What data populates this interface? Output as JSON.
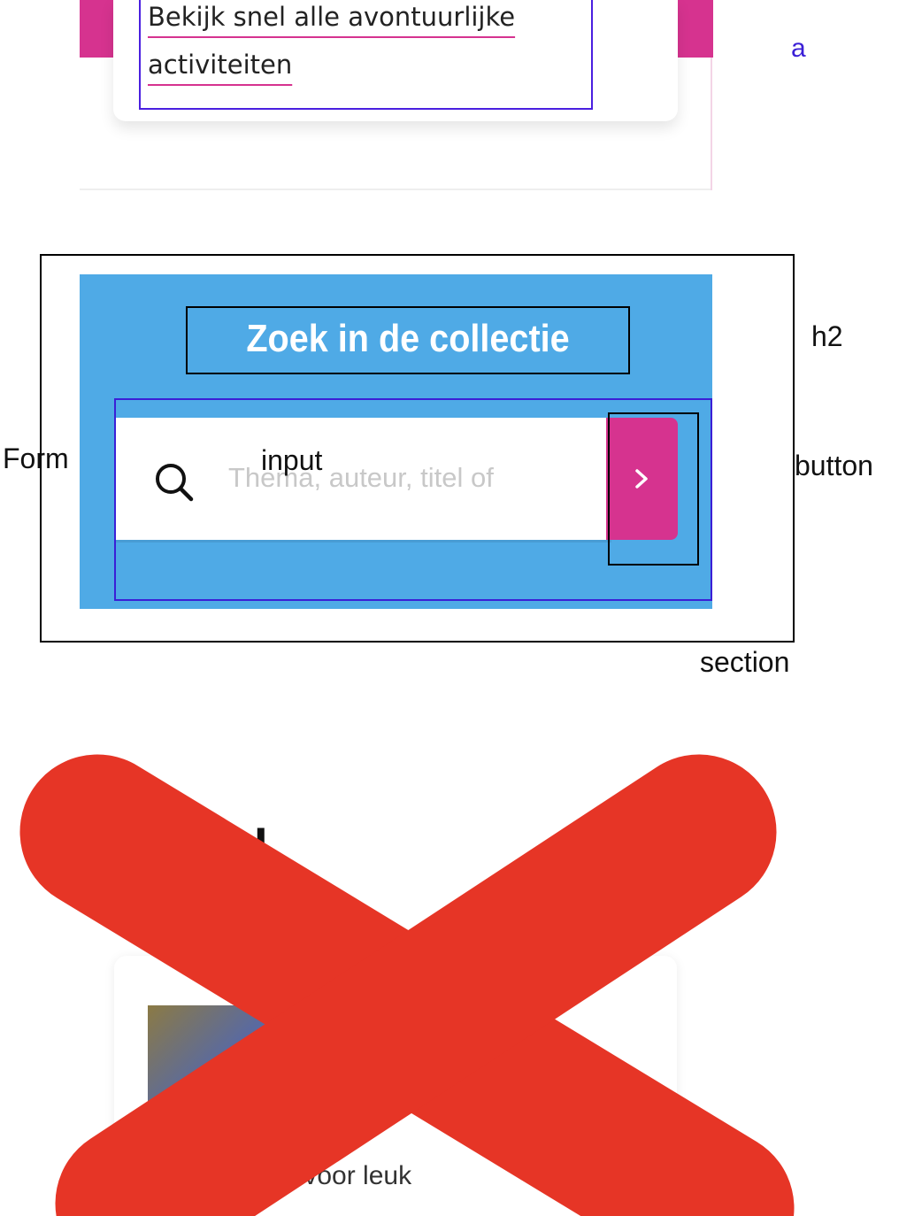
{
  "prev_card": {
    "link_text": "Bekijk snel alle avontuurlijke activiteiten",
    "accent_color": "#d6338f"
  },
  "search_section": {
    "title": "Zoek in de collectie",
    "input_placeholder": "Thema, auteur, titel of",
    "submit_icon": "chevron-right-icon",
    "search_icon": "search-icon",
    "panel_color": "#4faae6",
    "button_color": "#d6338f"
  },
  "annotations": {
    "a": "a",
    "h2": "h2",
    "form": "Form",
    "input": "input",
    "button": "button",
    "section": "section"
  },
  "next_card": {
    "title_fragment": "nd",
    "text_fragment": "lier wat voor leuk"
  },
  "overlay": {
    "cross_color": "#e63526"
  }
}
